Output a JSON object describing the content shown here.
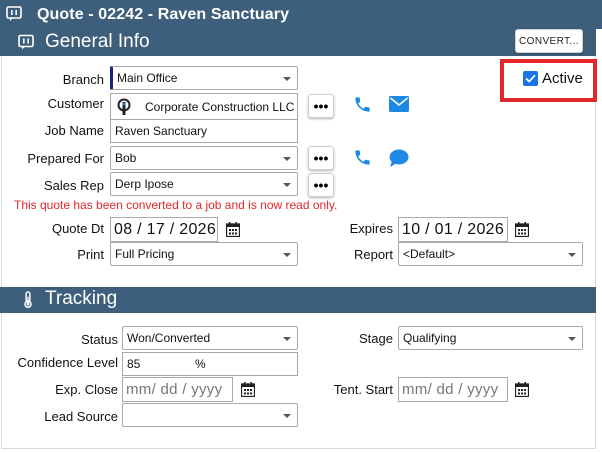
{
  "window": {
    "title": "Quote - 02242 - Raven Sanctuary"
  },
  "colors": {
    "header": "#3d5f7b",
    "accent": "#1e88e5",
    "warning": "#e2282d"
  },
  "general": {
    "heading": "General Info",
    "convert_label": "CONVERT...",
    "active_label": "Active",
    "active_checked": true,
    "branch": {
      "label": "Branch",
      "value": "Main Office"
    },
    "customer": {
      "label": "Customer",
      "value": "Corporate Construction LLC"
    },
    "job_name": {
      "label": "Job Name",
      "value": "Raven Sanctuary"
    },
    "prepared_for": {
      "label": "Prepared For",
      "value": "Bob"
    },
    "sales_rep": {
      "label": "Sales Rep",
      "value": "Derp Ipose"
    },
    "warning": "This quote has been converted to a job and is now read only.",
    "quote_dt": {
      "label": "Quote Dt",
      "value": "08 / 17 / 2026"
    },
    "expires": {
      "label": "Expires",
      "value": "10 / 01 / 2026"
    },
    "print": {
      "label": "Print",
      "value": "Full Pricing"
    },
    "report": {
      "label": "Report",
      "value": "<Default>"
    },
    "more_label": "•••"
  },
  "tracking": {
    "heading": "Tracking",
    "status": {
      "label": "Status",
      "value": "Won/Converted"
    },
    "stage": {
      "label": "Stage",
      "value": "Qualifying"
    },
    "confidence": {
      "label": "Confidence Level",
      "value": "85",
      "unit": "%"
    },
    "exp_close": {
      "label": "Exp. Close",
      "placeholder": "mm/ dd / yyyy"
    },
    "tent_start": {
      "label": "Tent. Start",
      "placeholder": "mm/ dd / yyyy"
    },
    "lead_source": {
      "label": "Lead Source",
      "value": ""
    }
  }
}
